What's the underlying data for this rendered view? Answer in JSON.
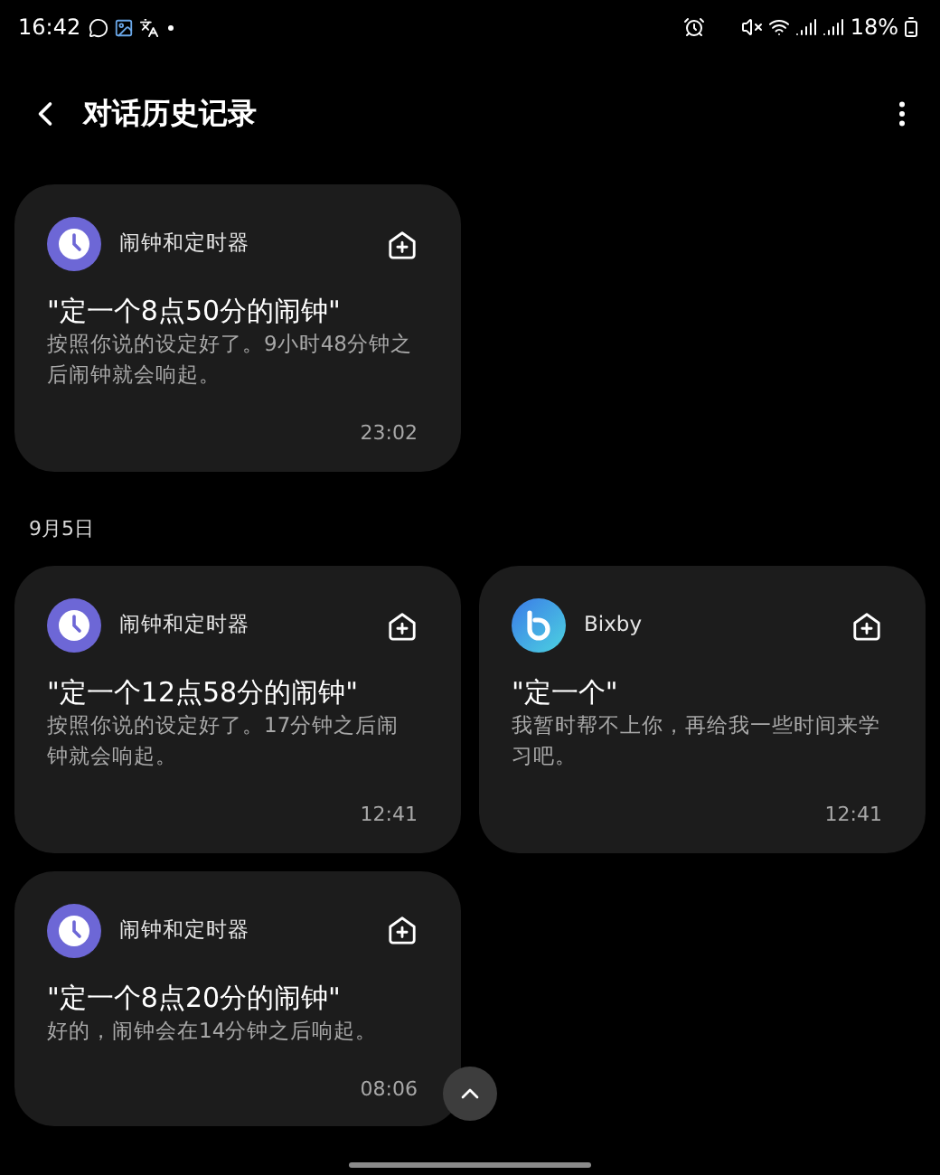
{
  "status_bar": {
    "time": "16:42",
    "battery": "18%"
  },
  "header": {
    "title": "对话历史记录"
  },
  "sections": [
    {
      "cards": [
        {
          "kind": "alarm",
          "app": "闹钟和定时器",
          "title": "\"定一个8点50分的闹钟\"",
          "reply": "按照你说的设定好了。9小时48分钟之后闹钟就会响起。",
          "time": "23:02"
        }
      ]
    },
    {
      "date": "9月5日",
      "cards": [
        {
          "kind": "alarm",
          "app": "闹钟和定时器",
          "title": "\"定一个12点58分的闹钟\"",
          "reply": "按照你说的设定好了。17分钟之后闹钟就会响起。",
          "time": "12:41"
        },
        {
          "kind": "bixby",
          "app": "Bixby",
          "title": "\"定一个\"",
          "reply": "我暂时帮不上你，再给我一些时间来学习吧。",
          "time": "12:41"
        },
        {
          "kind": "alarm",
          "app": "闹钟和定时器",
          "title": "\"定一个8点20分的闹钟\"",
          "reply": "好的，闹钟会在14分钟之后响起。",
          "time": "08:06"
        }
      ]
    }
  ]
}
